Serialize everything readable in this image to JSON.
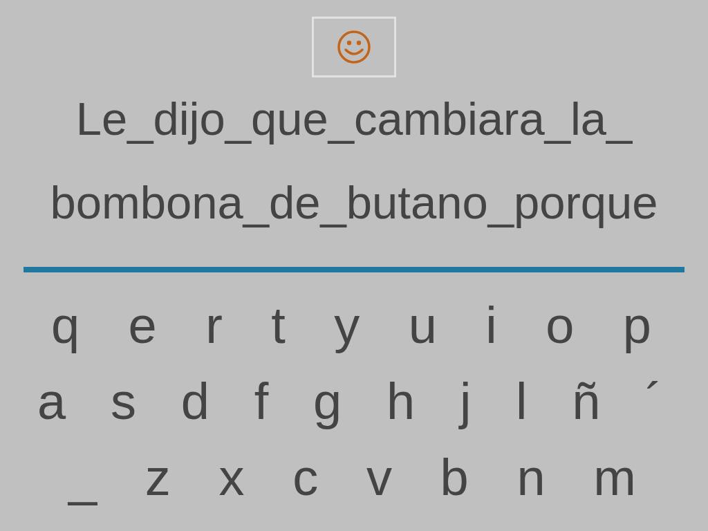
{
  "sentence_lines": [
    "Le_dijo_que_cambiara_la_",
    "bombona_de_butano_porque"
  ],
  "keyboard_rows": [
    [
      "q",
      "e",
      "r",
      "t",
      "y",
      "u",
      "i",
      "o",
      "p"
    ],
    [
      "a",
      "s",
      "d",
      "f",
      "g",
      "h",
      "j",
      "l",
      "ñ",
      "´"
    ],
    [
      "_",
      "z",
      "x",
      "c",
      "v",
      "b",
      "n",
      "m"
    ]
  ]
}
